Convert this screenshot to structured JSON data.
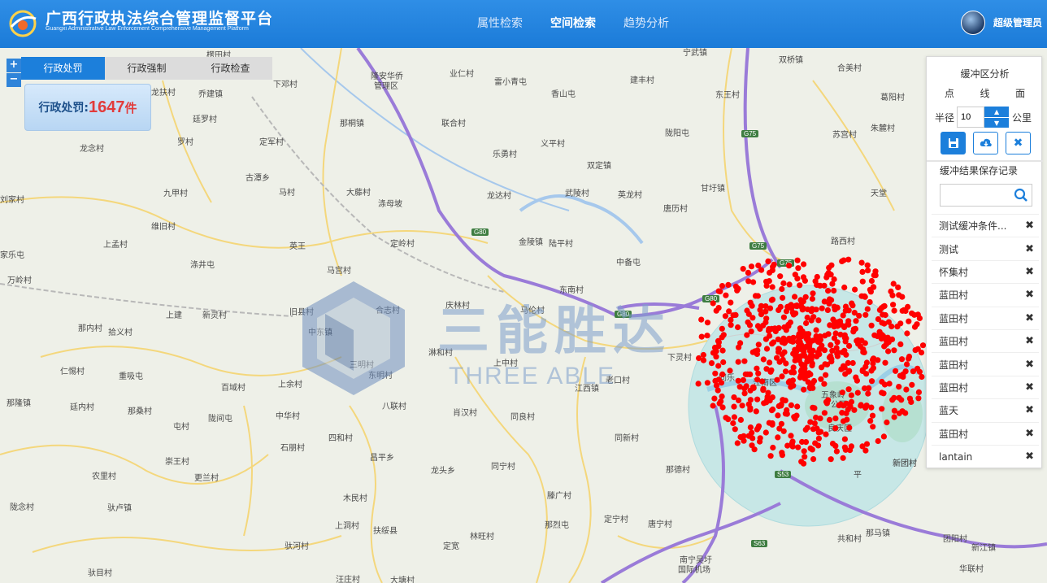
{
  "header": {
    "title": "广西行政执法综合管理监督平台",
    "subtitle": "Guangxi Administrative Law Enforcement Comprehensive Management Platform",
    "nav": [
      "属性检索",
      "空间检索",
      "趋势分析"
    ],
    "active_nav": "空间检索",
    "user": "超级管理员"
  },
  "map": {
    "zoom_in": "+",
    "zoom_out": "−",
    "tabs": [
      "行政处罚",
      "行政强制",
      "行政检查"
    ],
    "active_tab": "行政处罚",
    "count": {
      "label": "行政处罚:",
      "value": "1647",
      "unit": "件"
    },
    "watermark": {
      "cn": "三能胜达",
      "en": "THREE ABLE"
    },
    "places": [
      "楞田村",
      "隆安华侨",
      "管理区",
      "业仁村",
      "雷小青屯",
      "建丰村",
      "宁武镇",
      "双桥镇",
      "合美村",
      "龙扶村",
      "下邓村",
      "乔建镇",
      "香山屯",
      "东王村",
      "葛阳村",
      "廷罗村",
      "那桐镇",
      "联合村",
      "陇阳屯",
      "苏宫村",
      "朱麓村",
      "罗村",
      "定军村",
      "义平村",
      "乐勇村",
      "双定镇",
      "龙念村",
      "古潭乡",
      "九甲村",
      "马村",
      "大藤村",
      "涤母坡",
      "龙达村",
      "武陵村",
      "英龙村",
      "甘圩镇",
      "天堂",
      "刘家村",
      "唐历村",
      "维旧村",
      "定岭村",
      "金陵镇",
      "陆平村",
      "路西村",
      "上孟村",
      "英王",
      "家乐屯",
      "涤井屯",
      "中备屯",
      "万岭村",
      "马宫村",
      "庆林村",
      "东南村",
      "上建",
      "新灵村",
      "合志村",
      "马伦村",
      "旧县村",
      "那内村",
      "拾义村",
      "中东镇",
      "淋和村",
      "下灵村",
      "上中村",
      "三明村",
      "仁惕村",
      "重吸屯",
      "东明村",
      "老口村",
      "上余村",
      "百域村",
      "江西镇",
      "那隆镇",
      "廷内村",
      "那桑村",
      "八联村",
      "肖汉村",
      "同良村",
      "屯村",
      "陇间屯",
      "中华村",
      "同新村",
      "四和村",
      "石朋村",
      "崇王村",
      "昌平乡",
      "龙头乡",
      "同宁村",
      "那德村",
      "新团村",
      "更兰村",
      "农里村",
      "陇念村",
      "木民村",
      "滕广村",
      "定宁村",
      "驮卢镇",
      "扶绥县",
      "上洞村",
      "那烈屯",
      "唐宁村",
      "共和村",
      "团阳村",
      "新江镇",
      "驮河村",
      "林旺村",
      "定宽",
      "那马镇",
      "驮目村",
      "南宁吴圩",
      "国际机场",
      "华联村",
      "汪庄村",
      "大塘村",
      "同乐",
      "江南区",
      "五象岭",
      "公园",
      "良庆区",
      "新团村",
      "平"
    ],
    "roads": [
      "G75",
      "G75",
      "G75",
      "G80",
      "G80",
      "G80",
      "S53",
      "S63"
    ]
  },
  "panel": {
    "title": "缓冲区分析",
    "modes": [
      "点",
      "线",
      "面"
    ],
    "radius_label": "半径",
    "radius_value": "10",
    "radius_unit": "公里",
    "records_title": "缓冲结果保存记录",
    "search_placeholder": "",
    "records": [
      "测试缓冲条件...",
      "测试",
      "怀集村",
      "蓝田村",
      "蓝田村",
      "蓝田村",
      "蓝田村",
      "蓝田村",
      "蓝天",
      "蓝田村",
      "lantain"
    ],
    "delete_glyph": "✖"
  },
  "colors": {
    "header": "#1e80dc",
    "accent": "#1c7fdb",
    "dot": "#ff0000",
    "buffer": "#a8e0e6"
  }
}
